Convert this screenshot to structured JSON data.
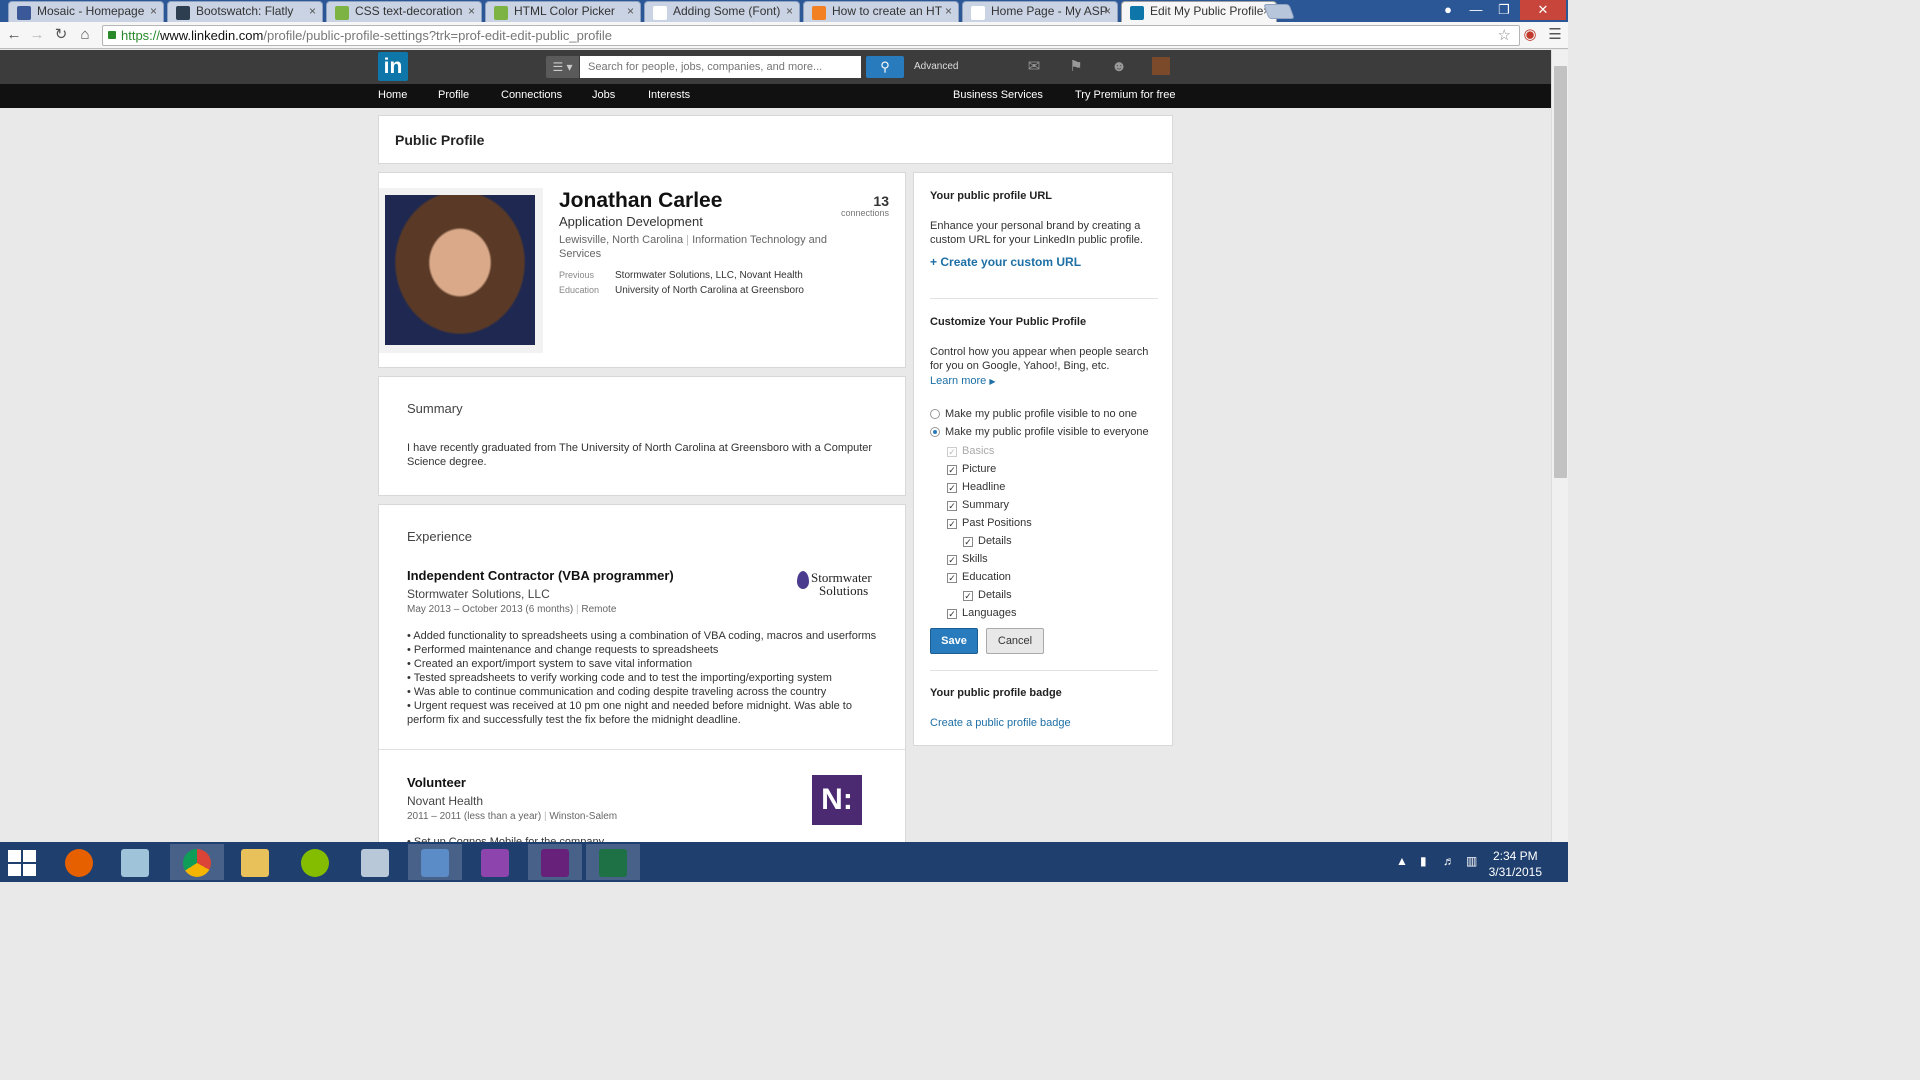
{
  "browser": {
    "tabs": [
      {
        "title": "Mosaic - Homepage",
        "color": "#3b5998"
      },
      {
        "title": "Bootswatch: Flatly",
        "color": "#2c3e50"
      },
      {
        "title": "CSS text-decoration",
        "color": "#7cb342"
      },
      {
        "title": "HTML Color Picker",
        "color": "#7cb342"
      },
      {
        "title": "Adding Some (Font)",
        "color": "#ffffff"
      },
      {
        "title": "How to create an HT",
        "color": "#f48024"
      },
      {
        "title": "Home Page - My ASP",
        "color": "#ffffff"
      },
      {
        "title": "Edit My Public Profile",
        "color": "#0e76a8"
      }
    ],
    "url_protocol": "https://",
    "url_domain": "www.linkedin.com",
    "url_path": "/profile/public-profile-settings?trk=prof-edit-edit-public_profile"
  },
  "linkedin": {
    "logo": "in",
    "search_placeholder": "Search for people, jobs, companies, and more...",
    "advanced": "Advanced",
    "nav": [
      "Home",
      "Profile",
      "Connections",
      "Jobs",
      "Interests"
    ],
    "nav_right": [
      "Business Services",
      "Try Premium for free"
    ]
  },
  "page": {
    "title": "Public Profile",
    "profile": {
      "name": "Jonathan Carlee",
      "headline": "Application Development",
      "location": "Lewisville, North Carolina",
      "industry": "Information Technology and Services",
      "connections_count": "13",
      "connections_label": "connections",
      "previous_label": "Previous",
      "previous_value": "Stormwater Solutions, LLC, Novant Health",
      "education_label": "Education",
      "education_value": "University of North Carolina at Greensboro"
    },
    "summary": {
      "heading": "Summary",
      "text": "I have recently graduated from The University of North Carolina at Greensboro with a Computer Science degree."
    },
    "experience": {
      "heading": "Experience",
      "jobs": [
        {
          "title": "Independent Contractor (VBA programmer)",
          "company": "Stormwater Solutions, LLC",
          "dates": "May 2013 – October 2013 (6 months)",
          "location": "Remote",
          "logo_text_1": "Stormwater",
          "logo_text_2": "Solutions",
          "bullets": [
            "• Added functionality to spreadsheets using a combination of VBA coding, macros and userforms",
            "• Performed maintenance and change requests to spreadsheets",
            "• Created an export/import system to save vital information",
            "• Tested spreadsheets to verify working code and to test the importing/exporting system",
            "• Was able to continue communication and coding despite traveling across the country",
            "• Urgent request was received at 10 pm one night and needed before midnight. Was able to perform fix and successfully test the fix before the midnight deadline."
          ]
        },
        {
          "title": "Volunteer",
          "company": "Novant Health",
          "dates": "2011 – 2011 (less than a year)",
          "location": "Winston-Salem",
          "logo_text": "N:",
          "bullets": [
            "• Set up Cognos Mobile for the company"
          ]
        }
      ]
    },
    "sidebar": {
      "url_heading": "Your public profile URL",
      "url_text": "Enhance your personal brand by creating a custom URL for your LinkedIn public profile.",
      "url_link": "Create your custom URL",
      "customize_heading": "Customize Your Public Profile",
      "customize_text": "Control how you appear when people search for you on Google, Yahoo!, Bing, etc.",
      "learn_more": "Learn more",
      "visibility_options": [
        {
          "label": "Make my public profile visible to no one",
          "selected": false
        },
        {
          "label": "Make my public profile visible to everyone",
          "selected": true
        }
      ],
      "sections": [
        {
          "label": "Basics",
          "checked": true,
          "disabled": true,
          "indent": 0
        },
        {
          "label": "Picture",
          "checked": true,
          "disabled": false,
          "indent": 0
        },
        {
          "label": "Headline",
          "checked": true,
          "disabled": false,
          "indent": 0
        },
        {
          "label": "Summary",
          "checked": true,
          "disabled": false,
          "indent": 0
        },
        {
          "label": "Past Positions",
          "checked": true,
          "disabled": false,
          "indent": 0
        },
        {
          "label": "Details",
          "checked": true,
          "disabled": false,
          "indent": 1
        },
        {
          "label": "Skills",
          "checked": true,
          "disabled": false,
          "indent": 0
        },
        {
          "label": "Education",
          "checked": true,
          "disabled": false,
          "indent": 0
        },
        {
          "label": "Details",
          "checked": true,
          "disabled": false,
          "indent": 1
        },
        {
          "label": "Languages",
          "checked": true,
          "disabled": false,
          "indent": 0
        }
      ],
      "save_label": "Save",
      "cancel_label": "Cancel",
      "badge_heading": "Your public profile badge",
      "badge_link": "Create a public profile badge"
    }
  },
  "taskbar": {
    "time": "2:34 PM",
    "date": "3/31/2015"
  }
}
